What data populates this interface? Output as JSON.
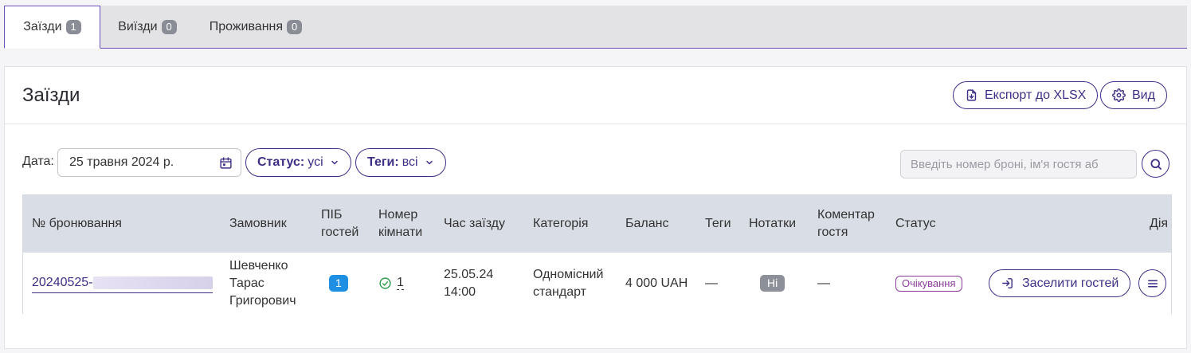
{
  "tabs": [
    {
      "label": "Заїзди",
      "count": "1",
      "active": true
    },
    {
      "label": "Виїзди",
      "count": "0",
      "active": false
    },
    {
      "label": "Проживання",
      "count": "0",
      "active": false
    }
  ],
  "panel": {
    "title": "Заїзди",
    "export_label": "Експорт до XLSX",
    "view_label": "Вид"
  },
  "filters": {
    "date_label": "Дата:",
    "date_value": "25 травня 2024 р.",
    "status_key": "Статус:",
    "status_value": "усі",
    "tags_key": "Теги:",
    "tags_value": "всі",
    "search_placeholder": "Введіть номер броні, ім'я гостя аб"
  },
  "table": {
    "headers": {
      "booking": "№ бронювання",
      "customer": "Замовник",
      "guests_1": "ПІБ",
      "guests_2": "гостей",
      "room_1": "Номер",
      "room_2": "кімнати",
      "time": "Час заїзду",
      "category": "Категорія",
      "balance": "Баланс",
      "tags": "Теги",
      "notes": "Нотатки",
      "comment_1": "Коментар",
      "comment_2": "гостя",
      "status": "Статус",
      "action": "Дія"
    },
    "row": {
      "booking": "20240525-",
      "customer_1": "Шевченко",
      "customer_2": "Тарас",
      "customer_3": "Григорович",
      "guests": "1",
      "room": "1",
      "date": "25.05.24",
      "time": "14:00",
      "category_1": "Одномісний",
      "category_2": "стандарт",
      "balance": "4 000 UAH",
      "tags": "—",
      "notes": "Ні",
      "comment": "—",
      "status": "Очікування",
      "checkin_label": "Заселити гостей"
    }
  },
  "colors": {
    "accent": "#3e2f86",
    "status": "#8b3d9a",
    "guest_badge": "#1f8fe4",
    "check": "#2e9b4a"
  }
}
